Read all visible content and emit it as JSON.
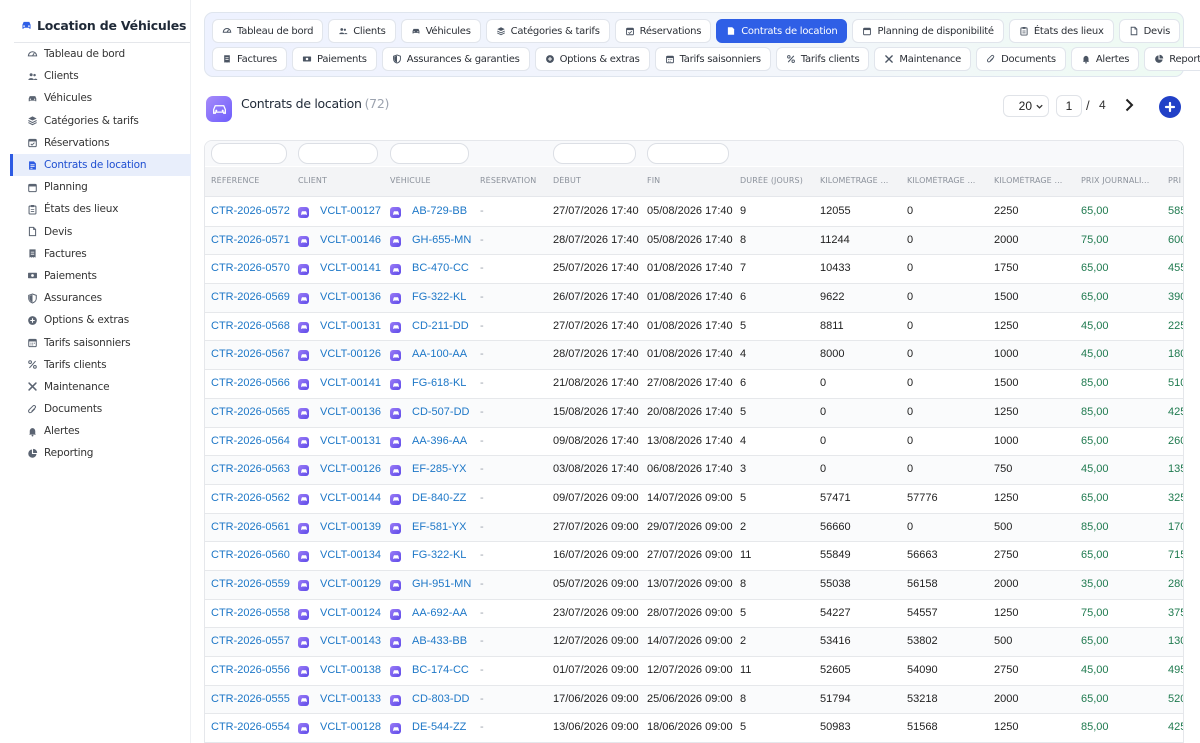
{
  "sidebar": {
    "title": "Location de Véhicules",
    "items": [
      {
        "label": "Tableau de bord",
        "icon": "dashboard-icon",
        "active": false
      },
      {
        "label": "Clients",
        "icon": "users-icon",
        "active": false
      },
      {
        "label": "Véhicules",
        "icon": "car-icon",
        "active": false
      },
      {
        "label": "Catégories & tarifs",
        "icon": "layers-icon",
        "active": false
      },
      {
        "label": "Réservations",
        "icon": "calendar-check-icon",
        "active": false
      },
      {
        "label": "Contrats de location",
        "icon": "contract-icon",
        "active": true
      },
      {
        "label": "Planning",
        "icon": "calendar-icon",
        "active": false
      },
      {
        "label": "États des lieux",
        "icon": "clipboard-icon",
        "active": false
      },
      {
        "label": "Devis",
        "icon": "file-icon",
        "active": false
      },
      {
        "label": "Factures",
        "icon": "invoice-icon",
        "active": false
      },
      {
        "label": "Paiements",
        "icon": "money-icon",
        "active": false
      },
      {
        "label": "Assurances",
        "icon": "shield-icon",
        "active": false
      },
      {
        "label": "Options & extras",
        "icon": "plus-circle-icon",
        "active": false
      },
      {
        "label": "Tarifs saisonniers",
        "icon": "calendar-alt-icon",
        "active": false
      },
      {
        "label": "Tarifs clients",
        "icon": "percent-icon",
        "active": false
      },
      {
        "label": "Maintenance",
        "icon": "tools-icon",
        "active": false
      },
      {
        "label": "Documents",
        "icon": "paperclip-icon",
        "active": false
      },
      {
        "label": "Alertes",
        "icon": "bell-icon",
        "active": false
      },
      {
        "label": "Reporting",
        "icon": "chart-pie-icon",
        "active": false
      }
    ]
  },
  "topnav": {
    "row1": [
      {
        "label": "Tableau de bord",
        "icon": "dashboard-icon",
        "active": false
      },
      {
        "label": "Clients",
        "icon": "users-icon",
        "active": false
      },
      {
        "label": "Véhicules",
        "icon": "car-icon",
        "active": false
      },
      {
        "label": "Catégories & tarifs",
        "icon": "layers-icon",
        "active": false
      },
      {
        "label": "Réservations",
        "icon": "calendar-check-icon",
        "active": false
      },
      {
        "label": "Contrats de location",
        "icon": "contract-icon",
        "active": true
      },
      {
        "label": "Planning de disponibilité",
        "icon": "calendar-icon",
        "active": false
      },
      {
        "label": "États des lieux",
        "icon": "clipboard-icon",
        "active": false
      },
      {
        "label": "Devis",
        "icon": "file-icon",
        "active": false
      }
    ],
    "row2": [
      {
        "label": "Factures",
        "icon": "invoice-icon",
        "active": false
      },
      {
        "label": "Paiements",
        "icon": "money-icon",
        "active": false
      },
      {
        "label": "Assurances & garanties",
        "icon": "shield-icon",
        "active": false
      },
      {
        "label": "Options & extras",
        "icon": "plus-circle-icon",
        "active": false
      },
      {
        "label": "Tarifs saisonniers",
        "icon": "calendar-alt-icon",
        "active": false
      },
      {
        "label": "Tarifs clients",
        "icon": "percent-icon",
        "active": false
      },
      {
        "label": "Maintenance",
        "icon": "tools-icon",
        "active": false
      },
      {
        "label": "Documents",
        "icon": "paperclip-icon",
        "active": false
      },
      {
        "label": "Alertes",
        "icon": "bell-icon",
        "active": false
      },
      {
        "label": "Reporting",
        "icon": "chart-pie-icon",
        "active": false
      }
    ]
  },
  "page": {
    "title": "Contrats de location",
    "count": "(72)",
    "icon": "car-icon"
  },
  "pager": {
    "page_size": "20",
    "current_page": "1",
    "separator": "/",
    "total_pages": "4"
  },
  "colors": {
    "accent": "#2f5fe6",
    "link": "#1d77c7",
    "money": "#1f7a4f",
    "add_button": "#2140c7"
  },
  "table": {
    "columns": [
      "RÉFÉRENCE",
      "CLIENT",
      "VÉHICULE",
      "RÉSERVATION",
      "DÉBUT",
      "FIN",
      "DURÉE (JOURS)",
      "KILOMÉTRAGE ...",
      "KILOMÉTRAGE ...",
      "KILOMÉTRAGE ...",
      "PRIX JOURNALI...",
      "PRI"
    ],
    "rows": [
      [
        "CTR-2026-0572",
        "VCLT-00127",
        "AB-729-BB",
        "-",
        "27/07/2026 17:40",
        "05/08/2026 17:40",
        "9",
        "12055",
        "0",
        "2250",
        "65,00",
        "585"
      ],
      [
        "CTR-2026-0571",
        "VCLT-00146",
        "GH-655-MN",
        "-",
        "28/07/2026 17:40",
        "05/08/2026 17:40",
        "8",
        "11244",
        "0",
        "2000",
        "75,00",
        "600"
      ],
      [
        "CTR-2026-0570",
        "VCLT-00141",
        "BC-470-CC",
        "-",
        "25/07/2026 17:40",
        "01/08/2026 17:40",
        "7",
        "10433",
        "0",
        "1750",
        "65,00",
        "455"
      ],
      [
        "CTR-2026-0569",
        "VCLT-00136",
        "FG-322-KL",
        "-",
        "26/07/2026 17:40",
        "01/08/2026 17:40",
        "6",
        "9622",
        "0",
        "1500",
        "65,00",
        "390"
      ],
      [
        "CTR-2026-0568",
        "VCLT-00131",
        "CD-211-DD",
        "-",
        "27/07/2026 17:40",
        "01/08/2026 17:40",
        "5",
        "8811",
        "0",
        "1250",
        "45,00",
        "225"
      ],
      [
        "CTR-2026-0567",
        "VCLT-00126",
        "AA-100-AA",
        "-",
        "28/07/2026 17:40",
        "01/08/2026 17:40",
        "4",
        "8000",
        "0",
        "1000",
        "45,00",
        "180"
      ],
      [
        "CTR-2026-0566",
        "VCLT-00141",
        "FG-618-KL",
        "-",
        "21/08/2026 17:40",
        "27/08/2026 17:40",
        "6",
        "0",
        "0",
        "1500",
        "85,00",
        "510"
      ],
      [
        "CTR-2026-0565",
        "VCLT-00136",
        "CD-507-DD",
        "-",
        "15/08/2026 17:40",
        "20/08/2026 17:40",
        "5",
        "0",
        "0",
        "1250",
        "85,00",
        "425"
      ],
      [
        "CTR-2026-0564",
        "VCLT-00131",
        "AA-396-AA",
        "-",
        "09/08/2026 17:40",
        "13/08/2026 17:40",
        "4",
        "0",
        "0",
        "1000",
        "65,00",
        "260"
      ],
      [
        "CTR-2026-0563",
        "VCLT-00126",
        "EF-285-YX",
        "-",
        "03/08/2026 17:40",
        "06/08/2026 17:40",
        "3",
        "0",
        "0",
        "750",
        "45,00",
        "135"
      ],
      [
        "CTR-2026-0562",
        "VCLT-00144",
        "DE-840-ZZ",
        "-",
        "09/07/2026 09:00",
        "14/07/2026 09:00",
        "5",
        "57471",
        "57776",
        "1250",
        "65,00",
        "325"
      ],
      [
        "CTR-2026-0561",
        "VCLT-00139",
        "EF-581-YX",
        "-",
        "27/07/2026 09:00",
        "29/07/2026 09:00",
        "2",
        "56660",
        "0",
        "500",
        "85,00",
        "170"
      ],
      [
        "CTR-2026-0560",
        "VCLT-00134",
        "FG-322-KL",
        "-",
        "16/07/2026 09:00",
        "27/07/2026 09:00",
        "11",
        "55849",
        "56663",
        "2750",
        "65,00",
        "715"
      ],
      [
        "CTR-2026-0559",
        "VCLT-00129",
        "GH-951-MN",
        "-",
        "05/07/2026 09:00",
        "13/07/2026 09:00",
        "8",
        "55038",
        "56158",
        "2000",
        "35,00",
        "280"
      ],
      [
        "CTR-2026-0558",
        "VCLT-00124",
        "AA-692-AA",
        "-",
        "23/07/2026 09:00",
        "28/07/2026 09:00",
        "5",
        "54227",
        "54557",
        "1250",
        "75,00",
        "375"
      ],
      [
        "CTR-2026-0557",
        "VCLT-00143",
        "AB-433-BB",
        "-",
        "12/07/2026 09:00",
        "14/07/2026 09:00",
        "2",
        "53416",
        "53802",
        "500",
        "65,00",
        "130"
      ],
      [
        "CTR-2026-0556",
        "VCLT-00138",
        "BC-174-CC",
        "-",
        "01/07/2026 09:00",
        "12/07/2026 09:00",
        "11",
        "52605",
        "54090",
        "2750",
        "45,00",
        "495"
      ],
      [
        "CTR-2026-0555",
        "VCLT-00133",
        "CD-803-DD",
        "-",
        "17/06/2026 09:00",
        "25/06/2026 09:00",
        "8",
        "51794",
        "53218",
        "2000",
        "65,00",
        "520"
      ],
      [
        "CTR-2026-0554",
        "VCLT-00128",
        "DE-544-ZZ",
        "-",
        "13/06/2026 09:00",
        "18/06/2026 09:00",
        "5",
        "50983",
        "51568",
        "1250",
        "85,00",
        "425"
      ]
    ]
  }
}
